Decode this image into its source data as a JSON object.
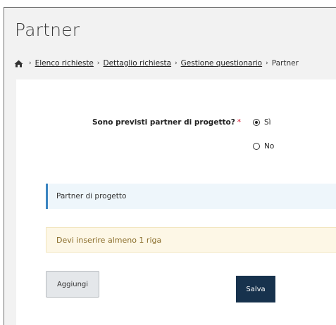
{
  "page": {
    "title": "Partner"
  },
  "breadcrumb": {
    "home_icon": "home-icon",
    "items": [
      {
        "label": "Elenco richieste"
      },
      {
        "label": "Dettaglio richiesta"
      },
      {
        "label": "Gestione questionario"
      },
      {
        "label": "Partner"
      }
    ],
    "separator": "›"
  },
  "question": {
    "label": "Sono previsti partner di progetto?",
    "required_marker": "*",
    "options": [
      {
        "label": "Sì",
        "checked": true
      },
      {
        "label": "No",
        "checked": false
      }
    ]
  },
  "section": {
    "title": "Partner di progetto",
    "accent_color": "#3a84c1"
  },
  "warning": {
    "text": "Devi inserire almeno 1 riga"
  },
  "actions": {
    "add_label": "Aggiungi",
    "save_label": "Salva",
    "save_color": "#17324d"
  }
}
